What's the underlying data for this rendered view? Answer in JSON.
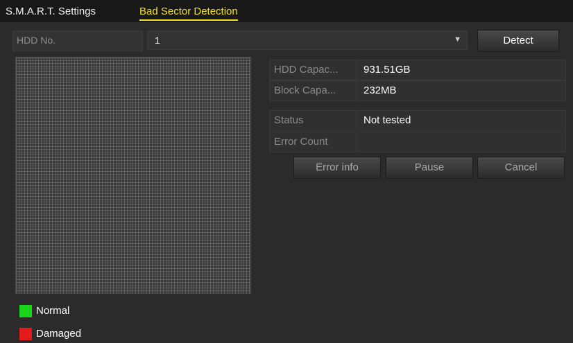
{
  "tabs": [
    {
      "label": "S.M.A.R.T. Settings",
      "active": false
    },
    {
      "label": "Bad Sector Detection",
      "active": true
    }
  ],
  "hdd": {
    "label": "HDD No.",
    "selected": "1",
    "detect_label": "Detect"
  },
  "info": {
    "hdd_capacity_label": "HDD Capac...",
    "hdd_capacity_value": "931.51GB",
    "block_capacity_label": "Block Capa...",
    "block_capacity_value": "232MB",
    "status_label": "Status",
    "status_value": "Not tested",
    "error_count_label": "Error Count",
    "error_count_value": ""
  },
  "buttons": {
    "error_info": "Error info",
    "pause": "Pause",
    "cancel": "Cancel"
  },
  "legend": [
    {
      "label": "Normal",
      "color": "#19d419"
    },
    {
      "label": "Damaged",
      "color": "#e51b1b"
    }
  ],
  "colors": {
    "active_tab": "#f2e11a",
    "background": "#2b2b2b"
  }
}
